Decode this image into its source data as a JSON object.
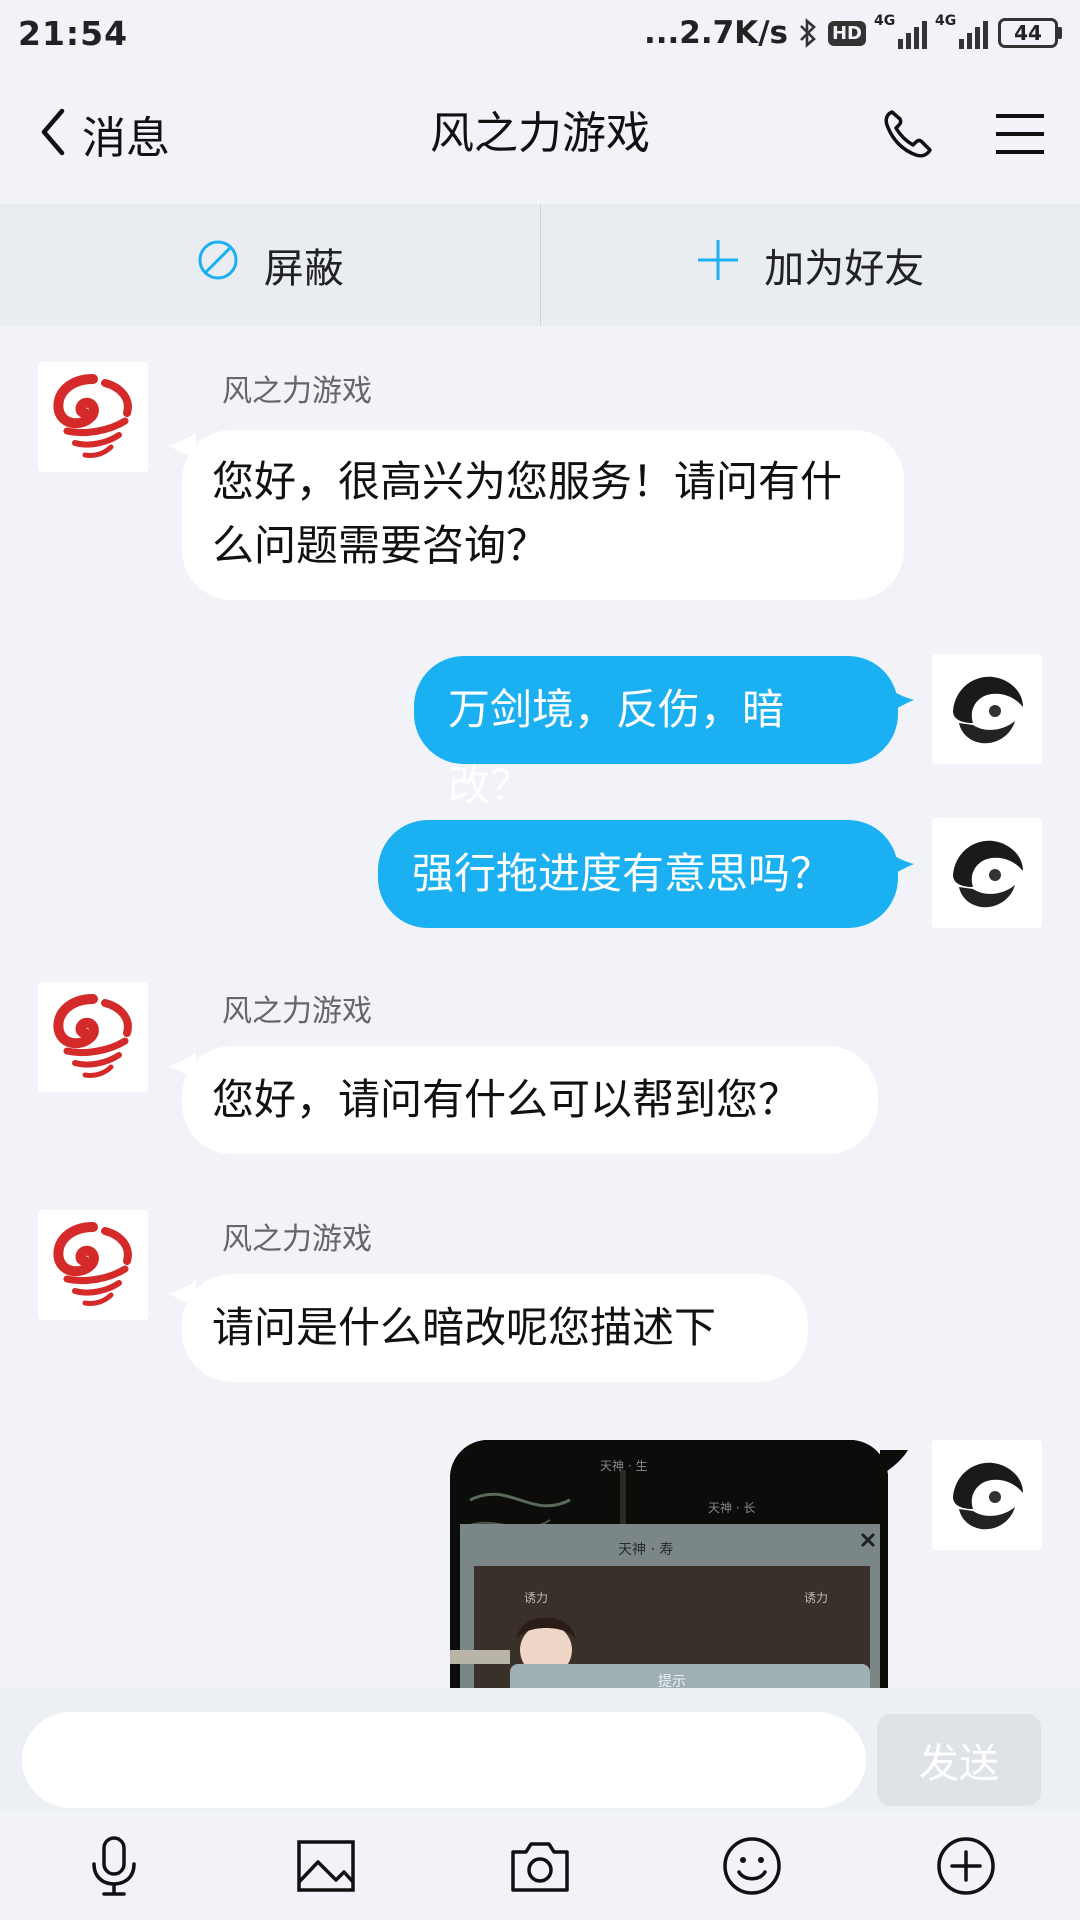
{
  "status_bar": {
    "time": "21:54",
    "net_speed": "...2.7K/s",
    "hd_badge": "HD",
    "signal_1_label": "4G",
    "signal_2_label": "4G",
    "battery": "44"
  },
  "header": {
    "back_label": "消息",
    "title": "风之力游戏"
  },
  "actions": {
    "block_label": "屏蔽",
    "add_friend_label": "加为好友"
  },
  "messages": [
    {
      "sender": "风之力游戏",
      "text": "您好，很高兴为您服务！请问有什么问题需要咨询？"
    },
    {
      "text": "万剑境，反伤，暗改？"
    },
    {
      "text": "强行拖进度有意思吗？"
    },
    {
      "sender": "风之力游戏",
      "text": "您好，请问有什么可以帮到您？"
    },
    {
      "sender": "风之力游戏",
      "text": "请问是什么暗改呢您描述下"
    }
  ],
  "image_message": {
    "label_1": "天神 · 生",
    "label_2": "天神 · 长",
    "label_3": "天神 · 寿",
    "label_4": "诱力",
    "label_5": "诱力",
    "label_6": "提示"
  },
  "input": {
    "placeholder": "",
    "send_label": "发送"
  },
  "colors": {
    "accent_blue": "#1ab0f2",
    "background": "#f1f3f8",
    "brand_red": "#d42a2a"
  },
  "icons": [
    "chevron-left-icon",
    "phone-icon",
    "menu-icon",
    "block-icon",
    "plus-icon",
    "microphone-icon",
    "image-icon",
    "camera-icon",
    "emoji-icon",
    "add-circle-icon"
  ]
}
